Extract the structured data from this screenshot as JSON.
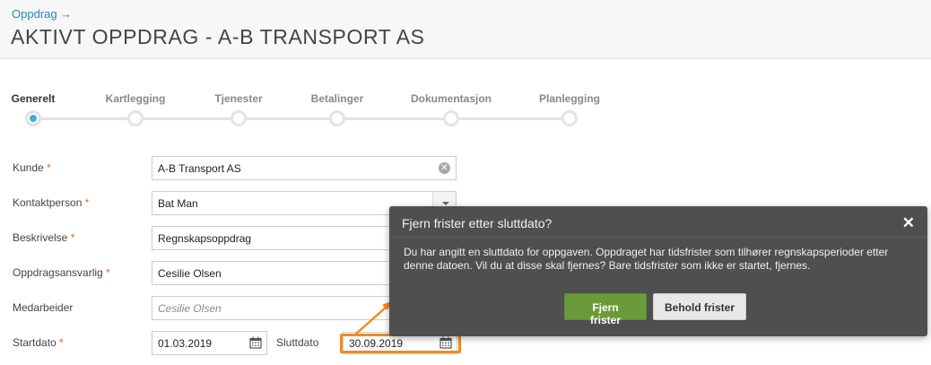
{
  "header": {
    "breadcrumb": "Oppdrag →",
    "title": "AKTIVT OPPDRAG - A-B TRANSPORT AS"
  },
  "stepper": {
    "steps": [
      {
        "label": "Generelt",
        "active": true
      },
      {
        "label": "Kartlegging",
        "active": false
      },
      {
        "label": "Tjenester",
        "active": false
      },
      {
        "label": "Betalinger",
        "active": false
      },
      {
        "label": "Dokumentasjon",
        "active": false
      },
      {
        "label": "Planlegging",
        "active": false
      }
    ]
  },
  "form": {
    "required_mark": "*",
    "kunde": {
      "label": "Kunde",
      "value": "A-B Transport AS"
    },
    "kontaktperson": {
      "label": "Kontaktperson",
      "value": "Bat Man"
    },
    "beskrivelse": {
      "label": "Beskrivelse",
      "value": "Regnskapsoppdrag"
    },
    "oppdragsansvarlig": {
      "label": "Oppdragsansvarlig",
      "value": "Cesilie Olsen"
    },
    "medarbeider": {
      "label": "Medarbeider",
      "placeholder": "Cesilie Olsen"
    },
    "startdato": {
      "label": "Startdato",
      "value": "01.03.2019"
    },
    "sluttdato": {
      "label": "Sluttdato",
      "value": "30.09.2019"
    }
  },
  "modal": {
    "title": "Fjern frister etter sluttdato?",
    "close": "✕",
    "body": "Du har angitt en sluttdato for oppgaven. Oppdraget har tidsfrister som tilhører regnskapsperioder etter denne datoen. Vil du at disse skal fjernes? Bare tidsfrister som ikke er startet, fjernes.",
    "confirm_label": "Fjern frister",
    "cancel_label": "Behold frister"
  },
  "colors": {
    "accent": "#1f8ac0",
    "required": "#e8681c",
    "highlight": "#f08a24",
    "modal_bg": "#4f4f4f",
    "primary_button": "#6a9b3a"
  }
}
